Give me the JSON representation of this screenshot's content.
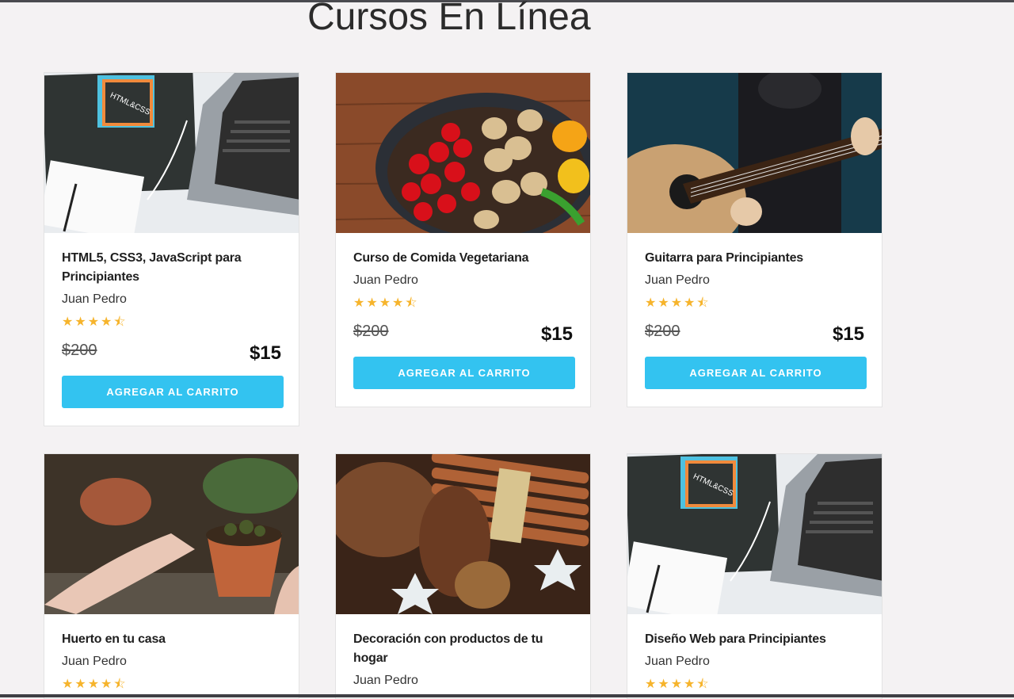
{
  "page": {
    "heading": "Cursos En Línea"
  },
  "colors": {
    "accent": "#33c3f0",
    "star": "#f6b42c",
    "background": "#f4f2f3"
  },
  "courses": [
    {
      "title": "HTML5, CSS3, JavaScript para Principiantes",
      "author": "Juan Pedro",
      "rating": 4.5,
      "old_price": "$200",
      "price": "$15",
      "button": "AGREGAR AL CARRITO",
      "image": "html-css-laptop"
    },
    {
      "title": "Curso de Comida Vegetariana",
      "author": "Juan Pedro",
      "rating": 4.5,
      "old_price": "$200",
      "price": "$15",
      "button": "AGREGAR AL CARRITO",
      "image": "vegetables-pot"
    },
    {
      "title": "Guitarra para Principiantes",
      "author": "Juan Pedro",
      "rating": 4.5,
      "old_price": "$200",
      "price": "$15",
      "button": "AGREGAR AL CARRITO",
      "image": "guitar-player"
    },
    {
      "title": "Huerto en tu casa",
      "author": "Juan Pedro",
      "rating": 4.5,
      "image": "plant-pot-hands"
    },
    {
      "title": "Decoración con productos de tu hogar",
      "author": "Juan Pedro",
      "image": "cinnamon-pinecone"
    },
    {
      "title": "Diseño Web para Principiantes",
      "author": "Juan Pedro",
      "rating": 4.5,
      "image": "html-css-laptop"
    }
  ]
}
